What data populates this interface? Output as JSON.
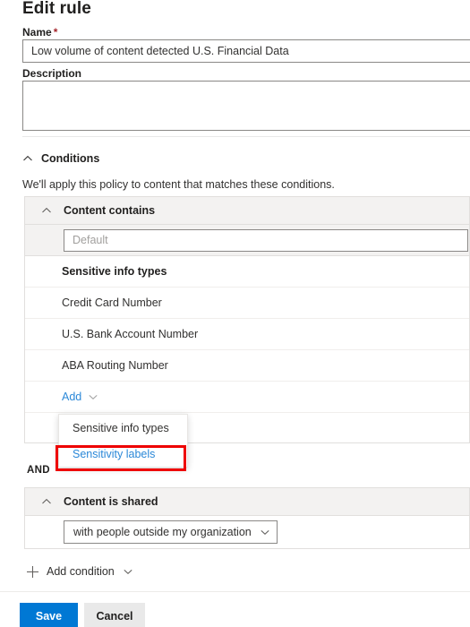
{
  "page": {
    "title": "Edit rule"
  },
  "form": {
    "name_label": "Name",
    "name_required_mark": "*",
    "name_value": "Low volume of content detected U.S. Financial Data",
    "description_label": "Description",
    "description_value": ""
  },
  "conditions": {
    "section_title": "Conditions",
    "section_description": "We'll apply this policy to content that matches these conditions.",
    "and_label": "AND",
    "add_condition_label": "Add condition",
    "groups": [
      {
        "header": "Content contains",
        "group_name_value": "Default",
        "list_header": "Sensitive info types",
        "items": [
          "Credit Card Number",
          "U.S. Bank Account Number",
          "ABA Routing Number"
        ],
        "add_label": "Add",
        "add_menu": {
          "open": true,
          "items": [
            {
              "label": "Sensitive info types",
              "highlighted": false
            },
            {
              "label": "Sensitivity labels",
              "highlighted": true
            }
          ]
        }
      },
      {
        "header": "Content is shared",
        "shared_with_value": "with people outside my organization"
      }
    ]
  },
  "footer": {
    "save_label": "Save",
    "cancel_label": "Cancel"
  },
  "colors": {
    "primary": "#0078d4",
    "link": "#2b88d8",
    "required": "#a4262c",
    "annotation": "#ee0000",
    "header_fill": "#f3f2f1",
    "border": "#e1dfdd"
  }
}
